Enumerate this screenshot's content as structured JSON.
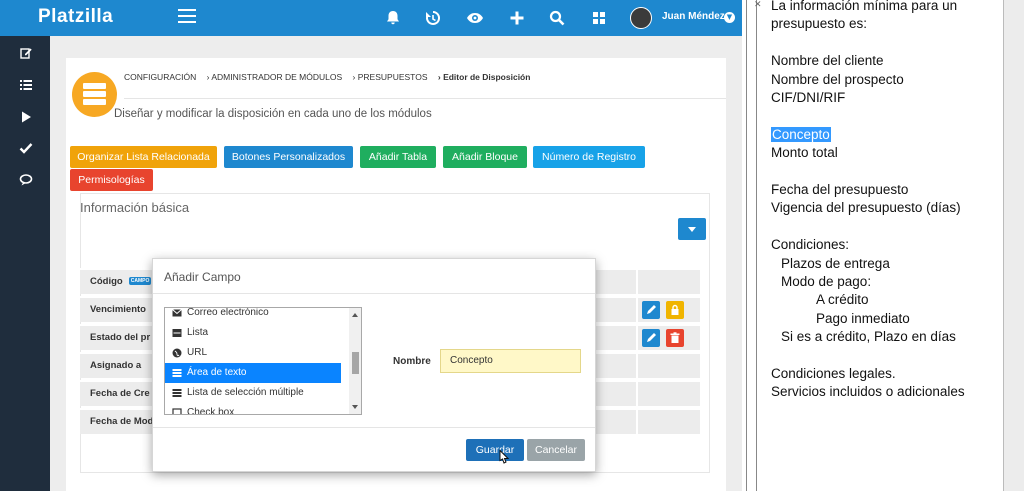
{
  "app": {
    "brand": "Platzilla",
    "user_name": "Juan Méndez",
    "colors": {
      "primary": "#1e88cf",
      "sidebar": "#1f2d3d",
      "accent_yellow": "#f7a823"
    }
  },
  "topbar_icons": [
    "bell-icon",
    "history-icon",
    "eye-icon",
    "plus-icon",
    "search-icon",
    "grid-icon"
  ],
  "sidebar_icons": [
    "edit-icon",
    "list-icon",
    "play-icon",
    "check-icon",
    "chat-icon"
  ],
  "breadcrumb": {
    "items": [
      "CONFIGURACIÓN",
      "› ADMINISTRADOR DE MÓDULOS",
      "› PRESUPUESTOS",
      "› Editor de Disposición"
    ]
  },
  "page": {
    "subtitle": "Diseñar y modificar la disposición en cada uno de los módulos"
  },
  "toolbar": {
    "buttons": [
      {
        "label": "Organizar Lista Relacionada",
        "color": "#f0a30a"
      },
      {
        "label": "Botones Personalizados",
        "color": "#1e88cf"
      },
      {
        "label": "Añadir Tabla",
        "color": "#1fae5f"
      },
      {
        "label": "Añadir Bloque",
        "color": "#1fae5f"
      },
      {
        "label": "Número de Registro",
        "color": "#17a2e8"
      },
      {
        "label": "Permisologías",
        "color": "#e8442e"
      }
    ]
  },
  "block": {
    "title": "Información básica",
    "rows": [
      {
        "label": "Código",
        "badge": "CAMPO"
      },
      {
        "label": "Vencimiento"
      },
      {
        "label": "Estado del pr"
      },
      {
        "label": "Asignado a"
      },
      {
        "label": "Fecha de Cre"
      },
      {
        "label": "Fecha de Mod"
      }
    ]
  },
  "modal": {
    "title": "Añadir Campo",
    "field_types": [
      {
        "label": "Correo electrónico",
        "icon": "envelope-icon",
        "selected": false
      },
      {
        "label": "Lista",
        "icon": "list-box-icon",
        "selected": false
      },
      {
        "label": "URL",
        "icon": "globe-icon",
        "selected": false
      },
      {
        "label": "Área de texto",
        "icon": "textarea-icon",
        "selected": true
      },
      {
        "label": "Lista de selección múltiple",
        "icon": "multilist-icon",
        "selected": false
      },
      {
        "label": "Check box",
        "icon": "checkbox-icon",
        "selected": false
      }
    ],
    "name_label": "Nombre",
    "name_value": "Concepto",
    "save_label": "Guardar",
    "cancel_label": "Cancelar"
  },
  "notes": {
    "lines": [
      {
        "text": "La información mínima para un",
        "indent": 0
      },
      {
        "text": "presupuesto es:",
        "indent": 0
      },
      {
        "text": "",
        "indent": 0
      },
      {
        "text": "Nombre del cliente",
        "indent": 0
      },
      {
        "text": "Nombre del prospecto",
        "indent": 0
      },
      {
        "text": "CIF/DNI/RIF",
        "indent": 0
      },
      {
        "text": "",
        "indent": 0
      },
      {
        "text": "Concepto",
        "indent": 0,
        "highlight": true
      },
      {
        "text": "Monto total",
        "indent": 0
      },
      {
        "text": "",
        "indent": 0
      },
      {
        "text": "Fecha del presupuesto",
        "indent": 0
      },
      {
        "text": "Vigencia del presupuesto (días)",
        "indent": 0
      },
      {
        "text": "",
        "indent": 0
      },
      {
        "text": "Condiciones:",
        "indent": 0
      },
      {
        "text": "Plazos de entrega",
        "indent": 1
      },
      {
        "text": "Modo de pago:",
        "indent": 1
      },
      {
        "text": "A crédito",
        "indent": 2
      },
      {
        "text": "Pago inmediato",
        "indent": 2
      },
      {
        "text": "Si es a crédito, Plazo en días",
        "indent": 1
      },
      {
        "text": "",
        "indent": 0
      },
      {
        "text": "Condiciones legales.",
        "indent": 0
      },
      {
        "text": "Servicios incluidos o adicionales",
        "indent": 0
      }
    ]
  }
}
